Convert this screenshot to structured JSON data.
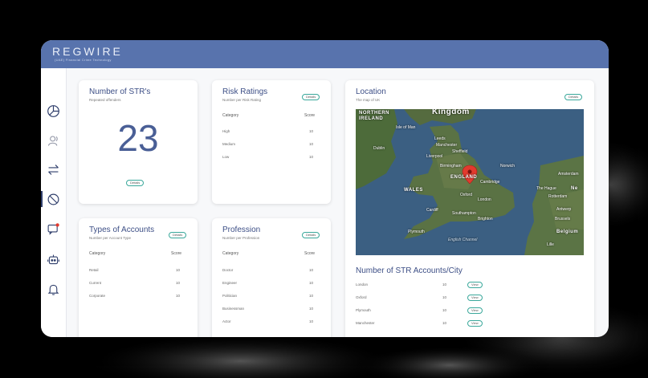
{
  "app": {
    "brand": "REGWIRE",
    "tagline": "(UAE) Financial Crime Technology"
  },
  "sidebar": {
    "items": [
      {
        "icon": "pie-chart-icon"
      },
      {
        "icon": "user-icon"
      },
      {
        "icon": "transfer-icon"
      },
      {
        "icon": "block-icon",
        "active": true
      },
      {
        "icon": "chat-alert-icon"
      },
      {
        "icon": "bot-icon"
      },
      {
        "icon": "bell-icon"
      }
    ]
  },
  "str_card": {
    "title": "Number of STR's",
    "subtitle": "Repeated offenders",
    "value": "23",
    "details_label": "Details"
  },
  "risk_card": {
    "title": "Risk Ratings",
    "subtitle": "Number per Risk Rating",
    "details_label": "Details",
    "col_category": "Category",
    "col_score": "Score",
    "rows": [
      {
        "category": "High",
        "score": "10"
      },
      {
        "category": "Medium",
        "score": "10"
      },
      {
        "category": "Low",
        "score": "10"
      }
    ]
  },
  "accounts_card": {
    "title": "Types of Accounts",
    "subtitle": "Number per Account Type",
    "details_label": "Details",
    "col_category": "Category",
    "col_score": "Score",
    "rows": [
      {
        "category": "Retail",
        "score": "10"
      },
      {
        "category": "Current",
        "score": "10"
      },
      {
        "category": "Corporate",
        "score": "10"
      }
    ]
  },
  "profession_card": {
    "title": "Profession",
    "subtitle": "Number per Profession",
    "details_label": "Details",
    "col_category": "Category",
    "col_score": "Score",
    "rows": [
      {
        "category": "Doctor",
        "score": "10"
      },
      {
        "category": "Engineer",
        "score": "10"
      },
      {
        "category": "Politician",
        "score": "10"
      },
      {
        "category": "Businessman",
        "score": "10"
      },
      {
        "category": "Actor",
        "score": "10"
      }
    ]
  },
  "location_card": {
    "title": "Location",
    "subtitle": "The map of UK",
    "details_label": "Details",
    "map_labels": {
      "kingdom": "Kingdom",
      "northern_ireland": "NORTHERN\nIRELAND",
      "isle_of_man": "Isle of Man",
      "dublin": "Dublin",
      "manchester": "Manchester",
      "liverpool": "Liverpool",
      "england": "ENGLAND",
      "wales": "WALES",
      "cambridge": "Cambridge",
      "oxford": "Oxford",
      "london": "London",
      "cardiff": "Cardiff",
      "southampton": "Southampton",
      "brighton": "Brighton",
      "plymouth": "Plymouth",
      "english_channel": "English Channel",
      "amsterdam": "Amsterdam",
      "the_hague": "The Hague",
      "rotterdam": "Rotterdam",
      "antwerp": "Antwerp",
      "brussels": "Brussels",
      "belgium": "Belgium",
      "netherlands": "Ne",
      "lille": "Lille",
      "leeds": "Leeds",
      "sheffield": "Sheffield",
      "birmingham": "Birmingham",
      "norwich": "Norwich"
    }
  },
  "city_card": {
    "title": "Number of STR Accounts/City",
    "view_label": "View",
    "rows": [
      {
        "city": "London",
        "count": "10"
      },
      {
        "city": "Oxford",
        "count": "10"
      },
      {
        "city": "Plymouth",
        "count": "10"
      },
      {
        "city": "Manchester",
        "count": "10"
      }
    ]
  },
  "colors": {
    "brand": "#5873ad",
    "accent": "#3aa89b",
    "title": "#3d4f86",
    "pin": "#e23a2e"
  }
}
